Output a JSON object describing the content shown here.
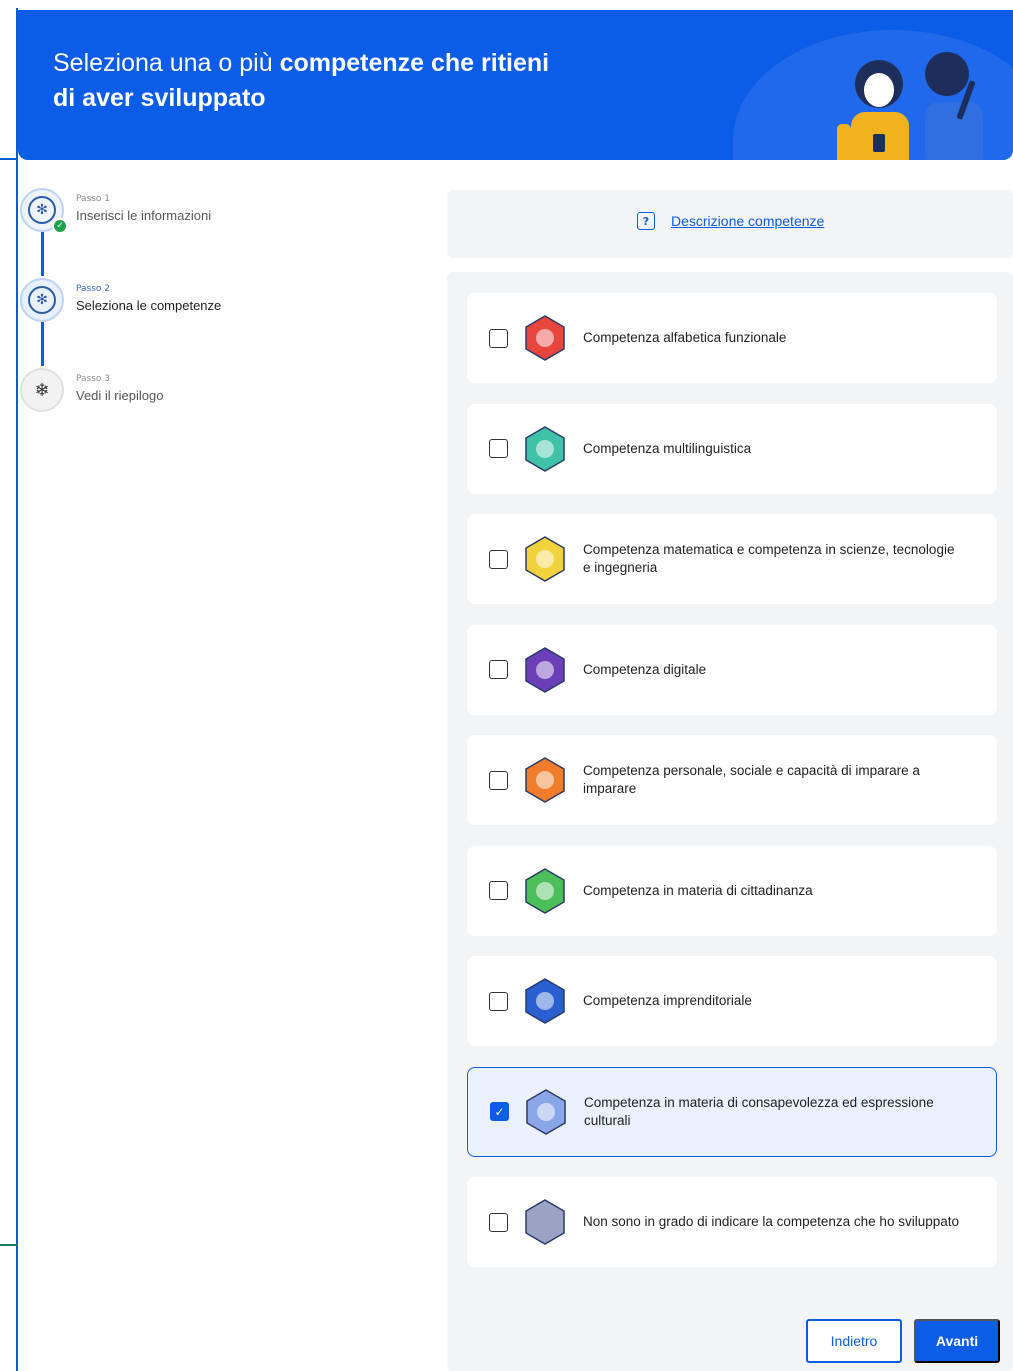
{
  "banner": {
    "title_regular": "Seleziona una o più ",
    "title_bold_1": "competenze che ritieni",
    "title_bold_2": "di aver sviluppato"
  },
  "stepper": {
    "steps": [
      {
        "small": "Passo 1",
        "label": "Inserisci le informazioni",
        "state": "done"
      },
      {
        "small": "Passo 2",
        "label": "Seleziona le competenze",
        "state": "active"
      },
      {
        "small": "Passo 3",
        "label": "Vedi il riepilogo",
        "state": "pending"
      }
    ]
  },
  "description_link": "Descrizione competenze",
  "competences": [
    {
      "label": "Competenza alfabetica funzionale",
      "checked": false,
      "color": "#e8453c"
    },
    {
      "label": "Competenza multilinguistica",
      "checked": false,
      "color": "#3fc2a8"
    },
    {
      "label": "Competenza matematica e competenza in scienze, tecnologie e ingegneria",
      "checked": false,
      "color": "#f2d23c"
    },
    {
      "label": "Competenza digitale",
      "checked": false,
      "color": "#6a3fb8"
    },
    {
      "label": "Competenza personale, sociale e capacità di imparare a imparare",
      "checked": false,
      "color": "#f07d2c"
    },
    {
      "label": "Competenza in materia di cittadinanza",
      "checked": false,
      "color": "#4cbe5a"
    },
    {
      "label": "Competenza imprenditoriale",
      "checked": false,
      "color": "#2a5fd0"
    },
    {
      "label": "Competenza in materia di consapevolezza ed espressione culturali",
      "checked": true,
      "color": "#8aa6e8"
    },
    {
      "label": "Non sono in grado di indicare la competenza che ho sviluppato",
      "checked": false,
      "color": "#9aa3c4"
    }
  ],
  "buttons": {
    "back": "Indietro",
    "next": "Avanti"
  },
  "colors": {
    "primary": "#0b5ce6",
    "panel": "#f3f4f6",
    "success": "#1aa34a"
  }
}
